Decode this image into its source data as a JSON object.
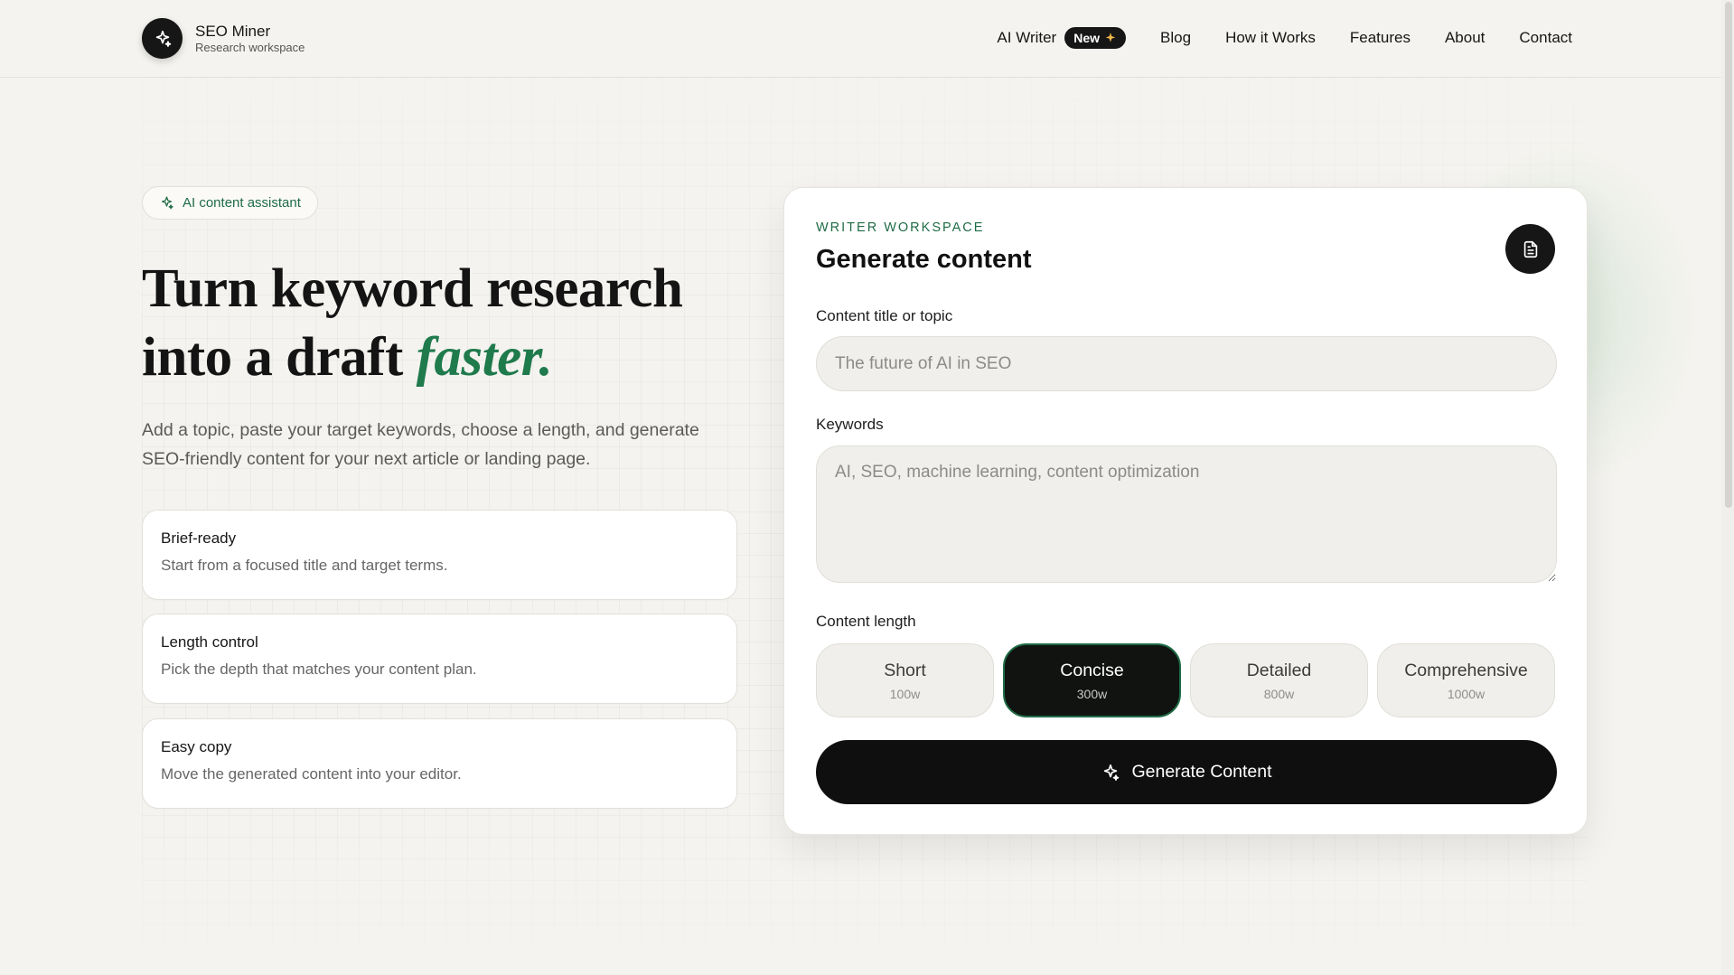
{
  "brand": {
    "name": "SEO Miner",
    "subtitle": "Research workspace"
  },
  "nav": {
    "ai_writer": "AI Writer",
    "new_badge": "New",
    "items": [
      "Blog",
      "How it Works",
      "Features",
      "About",
      "Contact"
    ]
  },
  "hero": {
    "pill": "AI content assistant",
    "title_line1": "Turn keyword research",
    "title_line2": "into a draft",
    "title_accent": "faster.",
    "description": "Add a topic, paste your target keywords, choose a length, and generate SEO-friendly content for your next article or landing page."
  },
  "features": [
    {
      "title": "Brief-ready",
      "body": "Start from a focused title and target terms."
    },
    {
      "title": "Length control",
      "body": "Pick the depth that matches your content plan."
    },
    {
      "title": "Easy copy",
      "body": "Move the generated content into your editor."
    }
  ],
  "workspace": {
    "eyebrow": "WRITER WORKSPACE",
    "title": "Generate content",
    "title_label": "Content title or topic",
    "title_placeholder": "The future of AI in SEO",
    "keywords_label": "Keywords",
    "keywords_placeholder": "AI, SEO, machine learning, content optimization",
    "length_label": "Content length",
    "lengths": [
      {
        "name": "Short",
        "words": "100w"
      },
      {
        "name": "Concise",
        "words": "300w"
      },
      {
        "name": "Detailed",
        "words": "800w"
      },
      {
        "name": "Comprehensive",
        "words": "1000w"
      }
    ],
    "selected_length": "Concise",
    "generate_label": "Generate Content"
  },
  "colors": {
    "accent": "#1f7a4c",
    "dark": "#161616",
    "background": "#f4f3ef"
  }
}
